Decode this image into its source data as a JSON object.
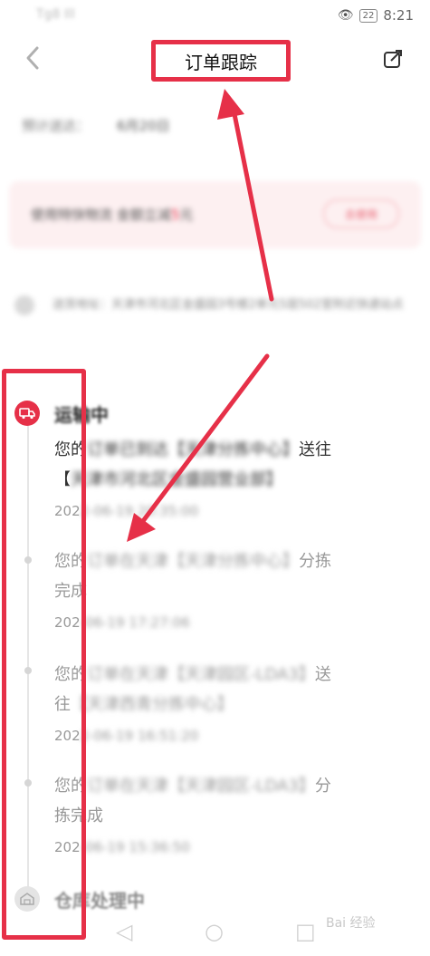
{
  "status_bar": {
    "carrier": "Tg8 Ill",
    "battery": "22",
    "time": "8:21"
  },
  "header": {
    "back_icon": "chevron-left-icon",
    "title": "订单跟踪",
    "share_icon": "share-icon"
  },
  "eta": {
    "label": "预计送达：",
    "value": "6月20日"
  },
  "banner": {
    "text_prefix": "使用特快物流 金额立减",
    "text_highlight": "5",
    "text_suffix": "元",
    "button_label": "去使用"
  },
  "address": {
    "text": "送货地址：天津市河北区金盛园3号楼2单元5层502室附近快递站点"
  },
  "timeline": {
    "transit_status": "运输中",
    "entries": [
      {
        "text_start": "您的",
        "text_blur": "订单已到达【天津分拣中心】",
        "text_end": "送往",
        "line2_start": "【",
        "line2_blur": "天津市河北区金盛园营业部】",
        "time_start": "202",
        "time_blur": "2-06-19 20:35:00"
      },
      {
        "text_start": "您的",
        "text_blur": "订单在天津【天津分拣中心】",
        "text_end": "分拣",
        "line2_start": "完成",
        "line2_blur": "",
        "time_start": "202",
        "time_blur": "-06-19 17:27:06"
      },
      {
        "text_start": "您的",
        "text_blur": "订单在天津【天津园区-LDA3】",
        "text_end": "送",
        "line2_start": "往",
        "line2_blur": "【天津西青分拣中心】",
        "time_start": "202",
        "time_blur": "2-06-19 16:51:20"
      },
      {
        "text_start": "您的",
        "text_blur": "订单在天津【天津园区-LDA3】",
        "text_end": "分",
        "line2_start": "拣完成",
        "line2_blur": "",
        "time_start": "202",
        "time_blur": "-06-19 15:36:50"
      }
    ],
    "warehouse_status": "仓库处理中"
  },
  "bottom_nav": {
    "back": "◁",
    "home": "○",
    "recent": "□"
  },
  "watermark": "Bai 经验",
  "colors": {
    "annotation_red": "#e63048",
    "accent": "#e63048"
  }
}
